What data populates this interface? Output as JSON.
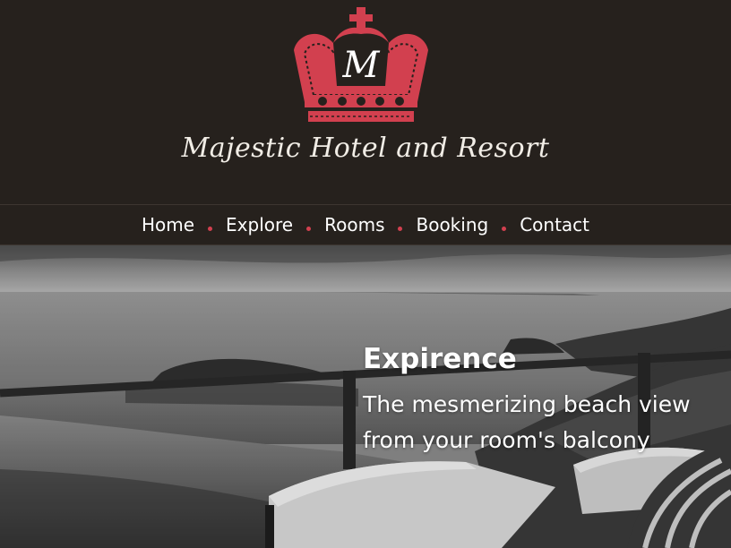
{
  "brand": {
    "monogram": "M",
    "name": "Majestic Hotel and Resort",
    "accent_color": "#d2404f"
  },
  "nav": {
    "items": [
      {
        "label": "Home"
      },
      {
        "label": "Explore"
      },
      {
        "label": "Rooms"
      },
      {
        "label": "Booking"
      },
      {
        "label": "Contact"
      }
    ]
  },
  "hero": {
    "title": "Expirence",
    "subtitle_line1": "The mesmerizing beach view",
    "subtitle_line2": "from your room's balcony",
    "image_icon": "beach-balcony-photo"
  }
}
